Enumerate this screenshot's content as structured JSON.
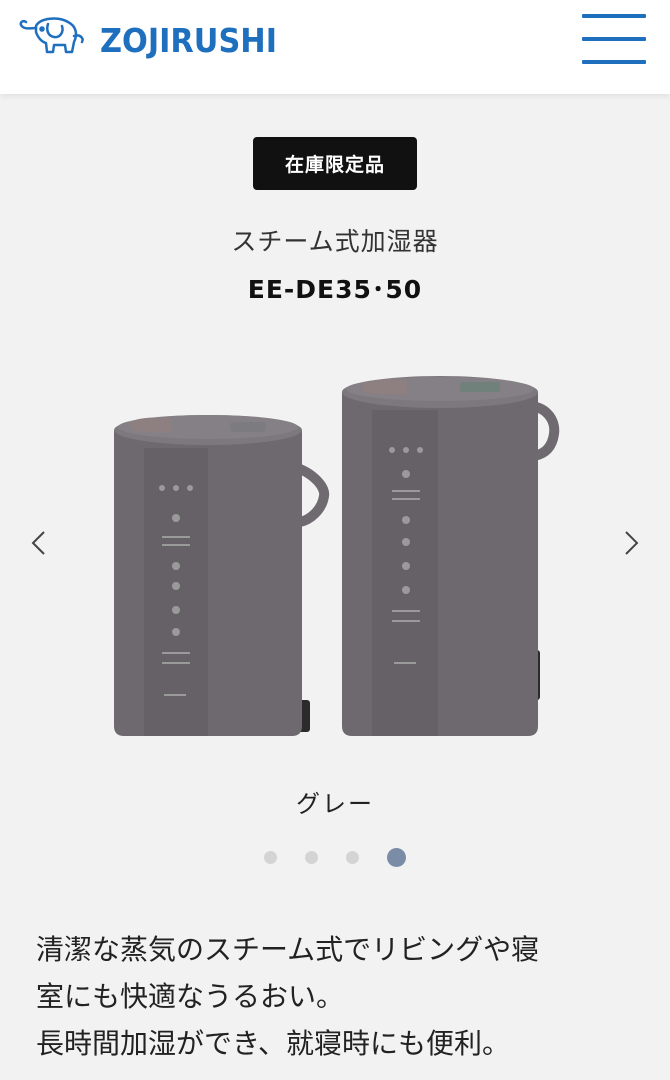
{
  "header": {
    "brand_name": "ZOJIRUSHI",
    "logo_icon": "elephant-logo-icon",
    "menu_icon": "hamburger-menu-icon",
    "brand_color": "#1f6fbf"
  },
  "product": {
    "badge": "在庫限定品",
    "category": "スチーム式加湿器",
    "model": "EE-DE35･50",
    "color_name": "グレー",
    "body_color": "#6f6a6f"
  },
  "carousel": {
    "prev_icon": "chevron-left-icon",
    "next_icon": "chevron-right-icon",
    "slide_count": 4,
    "active_index": 3,
    "dot_color": "#d4d4d4",
    "active_dot_color": "#7b8da6"
  },
  "description": {
    "lines": [
      "清潔な蒸気のスチーム式でリビングや寝",
      "室にも快適なうるおい。",
      "長時間加湿ができ、就寝時にも便利。"
    ]
  }
}
